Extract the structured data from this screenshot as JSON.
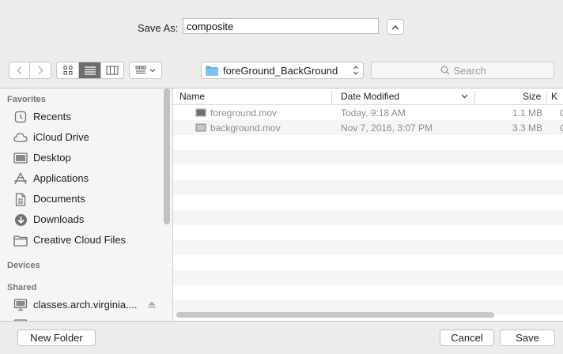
{
  "saveas": {
    "label": "Save As:",
    "value": "composite"
  },
  "location": {
    "folder": "foreGround_BackGround"
  },
  "search": {
    "placeholder": "Search"
  },
  "sidebar": {
    "favorites_header": "Favorites",
    "favorites": [
      {
        "label": "Recents",
        "icon": "clock-icon"
      },
      {
        "label": "iCloud Drive",
        "icon": "cloud-icon"
      },
      {
        "label": "Desktop",
        "icon": "desktop-icon"
      },
      {
        "label": "Applications",
        "icon": "applications-icon"
      },
      {
        "label": "Documents",
        "icon": "document-icon"
      },
      {
        "label": "Downloads",
        "icon": "download-icon"
      },
      {
        "label": "Creative Cloud Files",
        "icon": "folder-icon"
      }
    ],
    "devices_header": "Devices",
    "shared_header": "Shared",
    "shared": [
      {
        "label": "classes.arch.virginia....",
        "icon": "server-icon"
      }
    ]
  },
  "columns": {
    "name": "Name",
    "date": "Date Modified",
    "size": "Size",
    "kind": "K"
  },
  "files": [
    {
      "name": "foreground.mov",
      "date": "Today, 9:18 AM",
      "size": "1.1 MB",
      "kind": "Q"
    },
    {
      "name": "background.mov",
      "date": "Nov 7, 2016, 3:07 PM",
      "size": "3.3 MB",
      "kind": "Q"
    }
  ],
  "buttons": {
    "new_folder": "New Folder",
    "cancel": "Cancel",
    "save": "Save"
  },
  "colors": {
    "folder": "#5fb3ea",
    "selected_view": "#6d6d6d"
  }
}
